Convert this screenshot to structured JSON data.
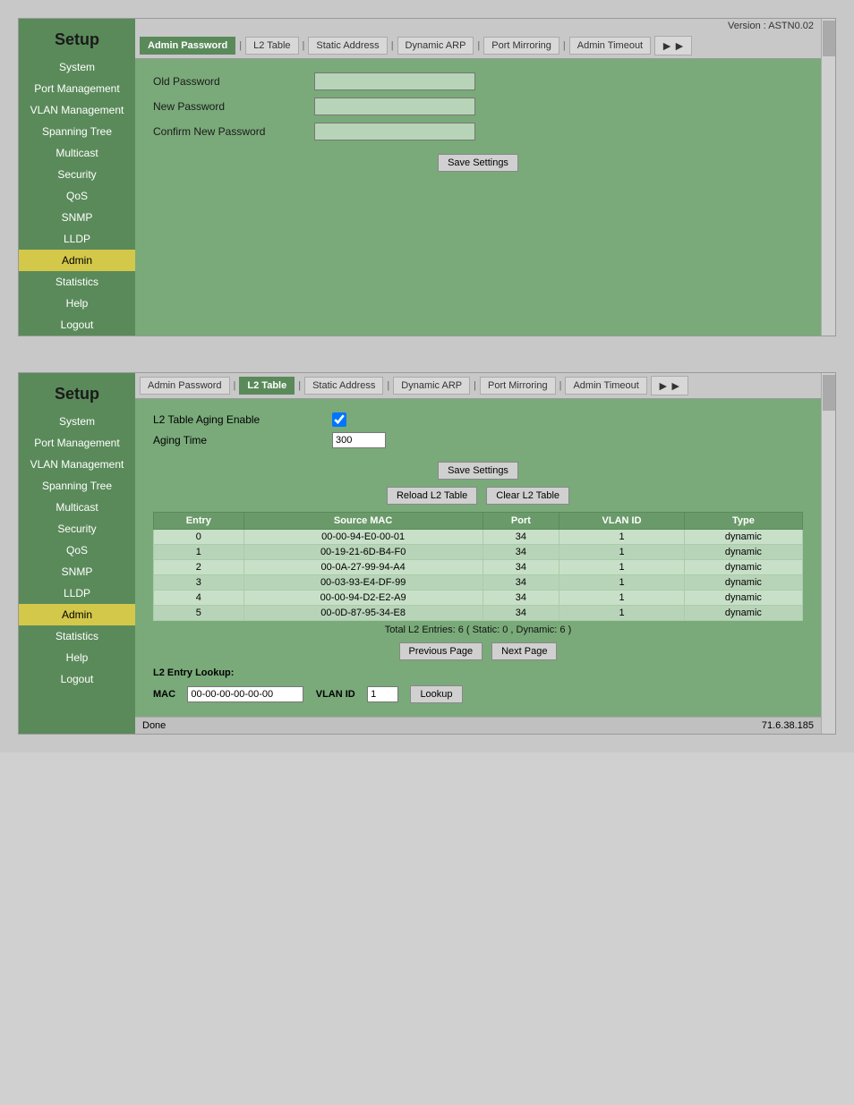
{
  "panel1": {
    "version": "Version : ASTN0.02",
    "sidebar": {
      "title": "Setup",
      "items": [
        {
          "label": "System",
          "active": false
        },
        {
          "label": "Port Management",
          "active": false
        },
        {
          "label": "VLAN Management",
          "active": false
        },
        {
          "label": "Spanning Tree",
          "active": false
        },
        {
          "label": "Multicast",
          "active": false
        },
        {
          "label": "Security",
          "active": false
        },
        {
          "label": "QoS",
          "active": false
        },
        {
          "label": "SNMP",
          "active": false
        },
        {
          "label": "LLDP",
          "active": false
        },
        {
          "label": "Admin",
          "active": true
        },
        {
          "label": "Statistics",
          "active": false
        },
        {
          "label": "Help",
          "active": false
        },
        {
          "label": "Logout",
          "active": false
        }
      ]
    },
    "tabs": [
      {
        "label": "Admin Password",
        "active": true
      },
      {
        "label": "L2 Table",
        "active": false
      },
      {
        "label": "Static Address",
        "active": false
      },
      {
        "label": "Dynamic ARP",
        "active": false
      },
      {
        "label": "Port Mirroring",
        "active": false
      },
      {
        "label": "Admin Timeout",
        "active": false
      }
    ],
    "form": {
      "old_password_label": "Old Password",
      "new_password_label": "New Password",
      "confirm_password_label": "Confirm New Password",
      "save_button": "Save Settings"
    }
  },
  "panel2": {
    "sidebar": {
      "title": "Setup",
      "items": [
        {
          "label": "System",
          "active": false
        },
        {
          "label": "Port Management",
          "active": false
        },
        {
          "label": "VLAN Management",
          "active": false
        },
        {
          "label": "Spanning Tree",
          "active": false
        },
        {
          "label": "Multicast",
          "active": false
        },
        {
          "label": "Security",
          "active": false
        },
        {
          "label": "QoS",
          "active": false
        },
        {
          "label": "SNMP",
          "active": false
        },
        {
          "label": "LLDP",
          "active": false
        },
        {
          "label": "Admin",
          "active": true
        },
        {
          "label": "Statistics",
          "active": false
        },
        {
          "label": "Help",
          "active": false
        },
        {
          "label": "Logout",
          "active": false
        }
      ]
    },
    "tabs": [
      {
        "label": "Admin Password",
        "active": false
      },
      {
        "label": "L2 Table",
        "active": true
      },
      {
        "label": "Static Address",
        "active": false
      },
      {
        "label": "Dynamic ARP",
        "active": false
      },
      {
        "label": "Port Mirroring",
        "active": false
      },
      {
        "label": "Admin Timeout",
        "active": false
      }
    ],
    "l2table": {
      "aging_enable_label": "L2 Table Aging Enable",
      "aging_time_label": "Aging Time",
      "aging_time_value": "300",
      "save_button": "Save Settings",
      "reload_button": "Reload L2 Table",
      "clear_button": "Clear L2 Table",
      "columns": [
        "Entry",
        "Source MAC",
        "Port",
        "VLAN ID",
        "Type"
      ],
      "rows": [
        {
          "entry": "0",
          "mac": "00-00-94-E0-00-01",
          "port": "34",
          "vlan": "1",
          "type": "dynamic"
        },
        {
          "entry": "1",
          "mac": "00-19-21-6D-B4-F0",
          "port": "34",
          "vlan": "1",
          "type": "dynamic"
        },
        {
          "entry": "2",
          "mac": "00-0A-27-99-94-A4",
          "port": "34",
          "vlan": "1",
          "type": "dynamic"
        },
        {
          "entry": "3",
          "mac": "00-03-93-E4-DF-99",
          "port": "34",
          "vlan": "1",
          "type": "dynamic"
        },
        {
          "entry": "4",
          "mac": "00-00-94-D2-E2-A9",
          "port": "34",
          "vlan": "1",
          "type": "dynamic"
        },
        {
          "entry": "5",
          "mac": "00-0D-87-95-34-E8",
          "port": "34",
          "vlan": "1",
          "type": "dynamic"
        }
      ],
      "total_entries": "Total L2 Entries: 6  ( Static: 0 , Dynamic: 6 )",
      "previous_button": "Previous Page",
      "next_button": "Next Page",
      "lookup_label": "L2 Entry Lookup:",
      "mac_label": "MAC",
      "mac_value": "00-00-00-00-00-00",
      "vlanid_label": "VLAN ID",
      "vlanid_value": "1",
      "lookup_button": "Lookup"
    },
    "bottom": {
      "done_label": "Done",
      "ip_label": "71.6.38.185"
    }
  }
}
